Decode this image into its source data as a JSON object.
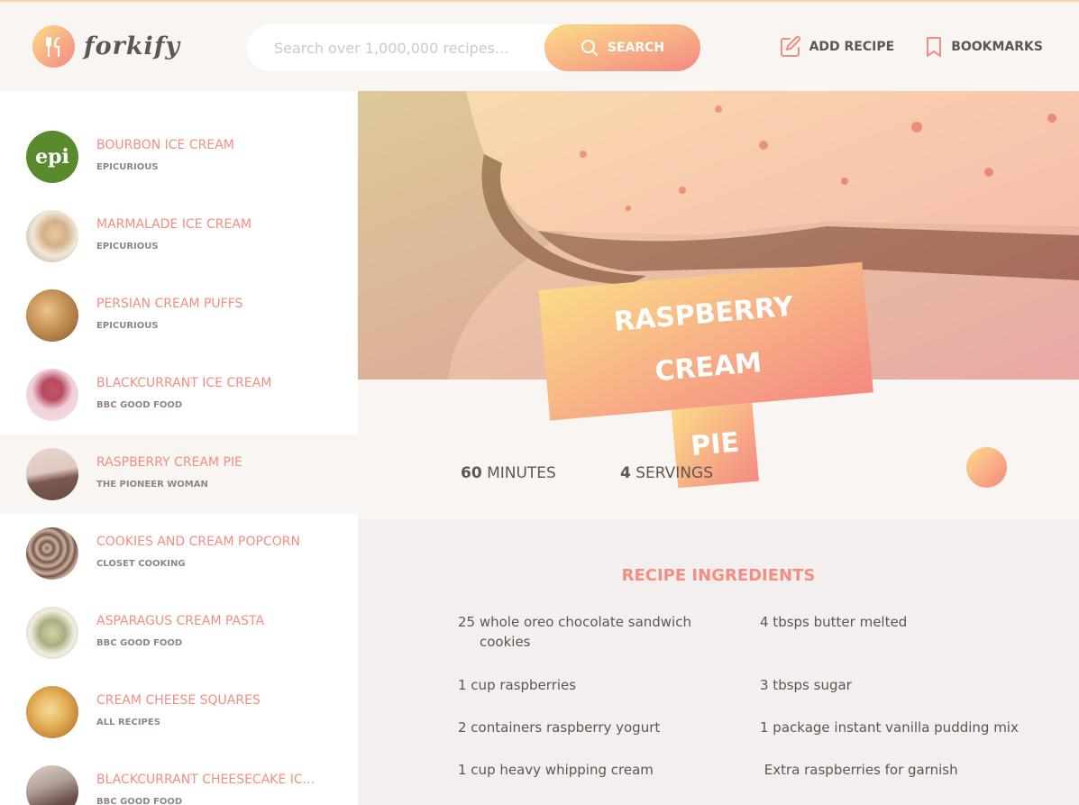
{
  "header": {
    "logo_text": "forkify",
    "search_placeholder": "Search over 1,000,000 recipes...",
    "search_button": "Search",
    "nav": [
      {
        "label": "Add recipe",
        "icon": "edit-icon"
      },
      {
        "label": "Bookmarks",
        "icon": "bookmark-icon"
      }
    ]
  },
  "results": [
    {
      "title": "Bourbon Ice Cream",
      "publisher": "Epicurious",
      "thumb": "epi-logo"
    },
    {
      "title": "Marmalade Ice Cream",
      "publisher": "Epicurious",
      "thumb": "food-photo"
    },
    {
      "title": "Persian Cream Puffs",
      "publisher": "Epicurious",
      "thumb": "food-photo"
    },
    {
      "title": "Blackcurrant Ice Cream",
      "publisher": "BBC Good Food",
      "thumb": "food-photo"
    },
    {
      "title": "Raspberry Cream Pie",
      "publisher": "The Pioneer Woman",
      "thumb": "food-photo",
      "active": true
    },
    {
      "title": "Cookies and Cream Popcorn",
      "publisher": "Closet Cooking",
      "thumb": "food-photo"
    },
    {
      "title": "Asparagus Cream Pasta",
      "publisher": "BBC Good Food",
      "thumb": "food-photo"
    },
    {
      "title": "Cream Cheese Squares",
      "publisher": "All Recipes",
      "thumb": "food-photo"
    },
    {
      "title": "Blackcurrant Cheesecake Ic...",
      "publisher": "BBC Good Food",
      "thumb": "food-photo"
    }
  ],
  "recipe": {
    "title_line1": "Raspberry Cream",
    "title_line2": "Pie",
    "minutes": "60",
    "minutes_label": "minutes",
    "servings": "4",
    "servings_label": "servings",
    "ingredients_heading": "Recipe ingredients",
    "ingredients": [
      "25 whole oreo chocolate sandwich cookies",
      "4 tbsps butter melted",
      "1 cup raspberries",
      "3 tbsps sugar",
      "2 containers raspberry yogurt",
      "1 package instant vanilla pudding mix",
      "1 cup heavy whipping cream",
      " Extra raspberries for garnish"
    ]
  },
  "colors": {
    "accent": "#f38e82",
    "gradient_start": "#fbdb89",
    "gradient_end": "#f48982",
    "text": "#615551",
    "bg": "#f9f5f3"
  }
}
